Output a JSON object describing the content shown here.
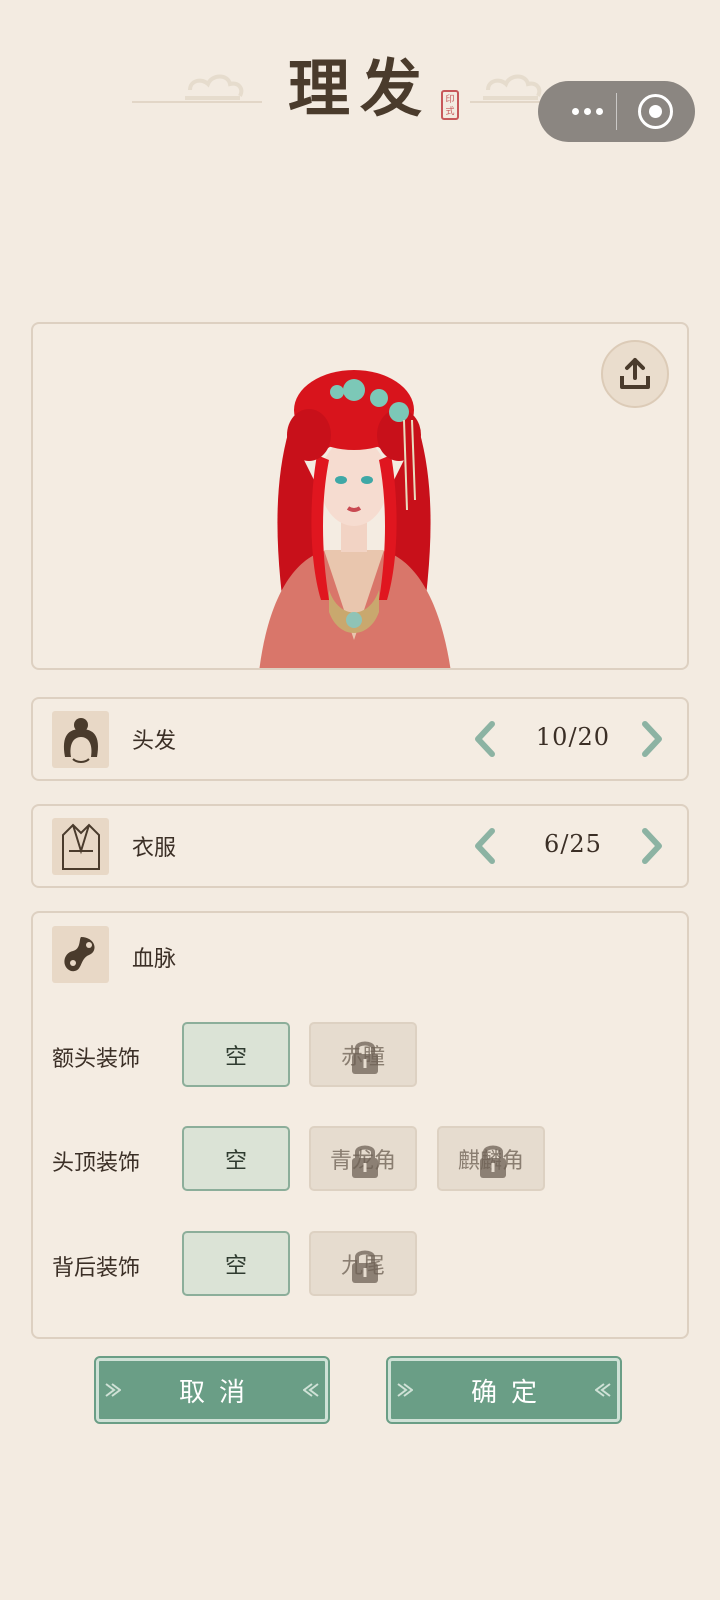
{
  "header": {
    "title": "理发",
    "seal_text": "印\n式"
  },
  "capsule": {
    "more_icon": "more-dots-icon",
    "close_icon": "target-circle-icon"
  },
  "preview": {
    "share_icon": "upload-share-icon"
  },
  "hair": {
    "label": "头发",
    "icon": "hairstyle-bun-icon",
    "counter": "10/20"
  },
  "clothes": {
    "label": "衣服",
    "icon": "robe-icon",
    "counter": "6/25"
  },
  "bloodline": {
    "label": "血脉",
    "icon": "taiji-swirl-icon",
    "rows": [
      {
        "label": "额头装饰",
        "options": [
          {
            "text": "空",
            "state": "selected"
          },
          {
            "text": "赤瞳",
            "state": "locked"
          }
        ]
      },
      {
        "label": "头顶装饰",
        "options": [
          {
            "text": "空",
            "state": "selected"
          },
          {
            "text": "青龙角",
            "state": "locked"
          },
          {
            "text": "麒麟角",
            "state": "locked"
          }
        ]
      },
      {
        "label": "背后装饰",
        "options": [
          {
            "text": "空",
            "state": "selected"
          },
          {
            "text": "九尾",
            "state": "locked"
          }
        ]
      }
    ]
  },
  "buttons": {
    "cancel": "取消",
    "confirm": "确定"
  },
  "colors": {
    "background": "#f3ebe1",
    "accent_green": "#6a9e86",
    "hair_red": "#d8141c",
    "dress": "#d9766a"
  }
}
